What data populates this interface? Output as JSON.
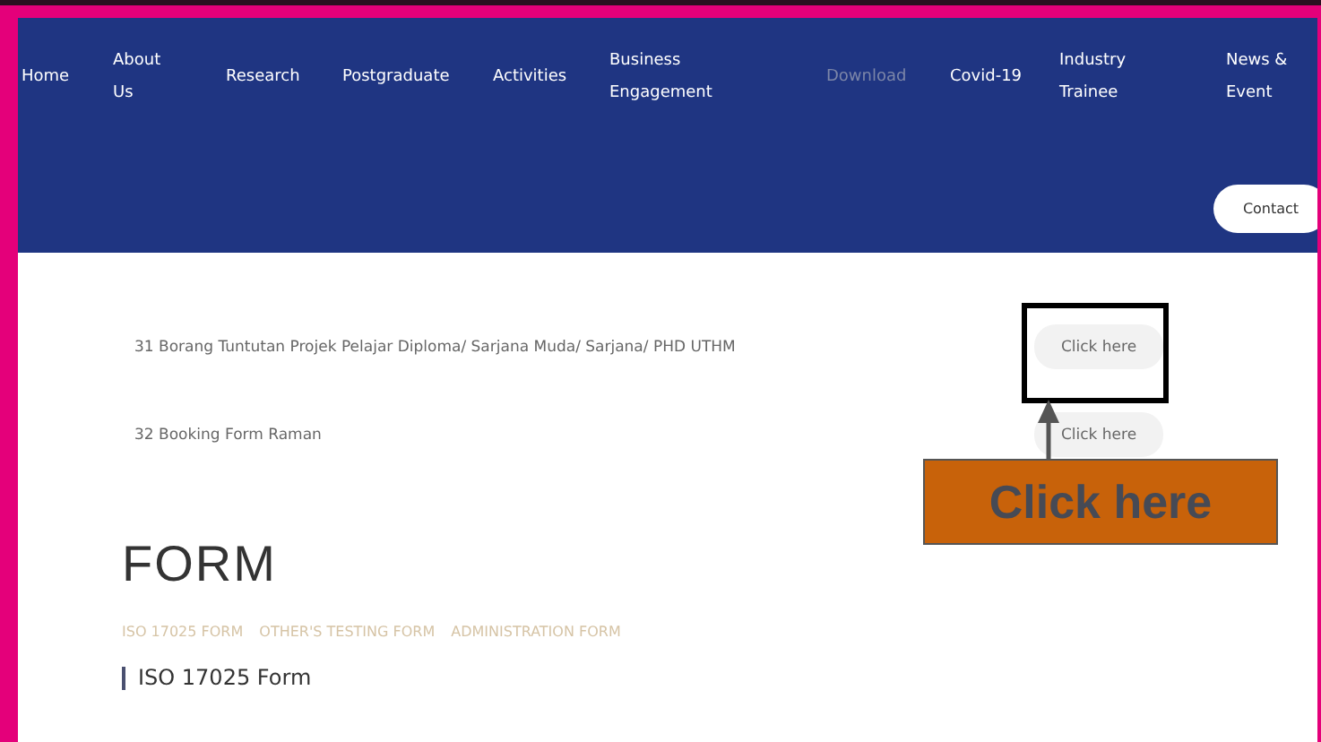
{
  "nav": {
    "items": [
      {
        "label": "Home",
        "selected": false
      },
      {
        "label": "About Us",
        "selected": false
      },
      {
        "label": "Research",
        "selected": false
      },
      {
        "label": "Postgraduate",
        "selected": false
      },
      {
        "label": "Activities",
        "selected": false
      },
      {
        "label": "Business Engagement",
        "selected": false
      },
      {
        "label": "Download",
        "selected": true
      },
      {
        "label": "Covid-19",
        "selected": false
      },
      {
        "label": "Industry Trainee",
        "selected": false
      },
      {
        "label": "News & Event",
        "selected": false
      }
    ],
    "contact_button": "Contact"
  },
  "downloads": [
    {
      "title": "31 Borang Tuntutan Projek Pelajar Diploma/ Sarjana Muda/ Sarjana/ PHD UTHM",
      "button": "Click here"
    },
    {
      "title": "32 Booking Form Raman",
      "button": "Click here"
    }
  ],
  "form_section": {
    "heading": "FORM",
    "tabs": [
      "ISO 17025 FORM",
      "OTHER'S TESTING FORM",
      "ADMINISTRATION FORM"
    ],
    "subheading": "ISO 17025 Form"
  },
  "annotation": {
    "callout": "Click here"
  }
}
